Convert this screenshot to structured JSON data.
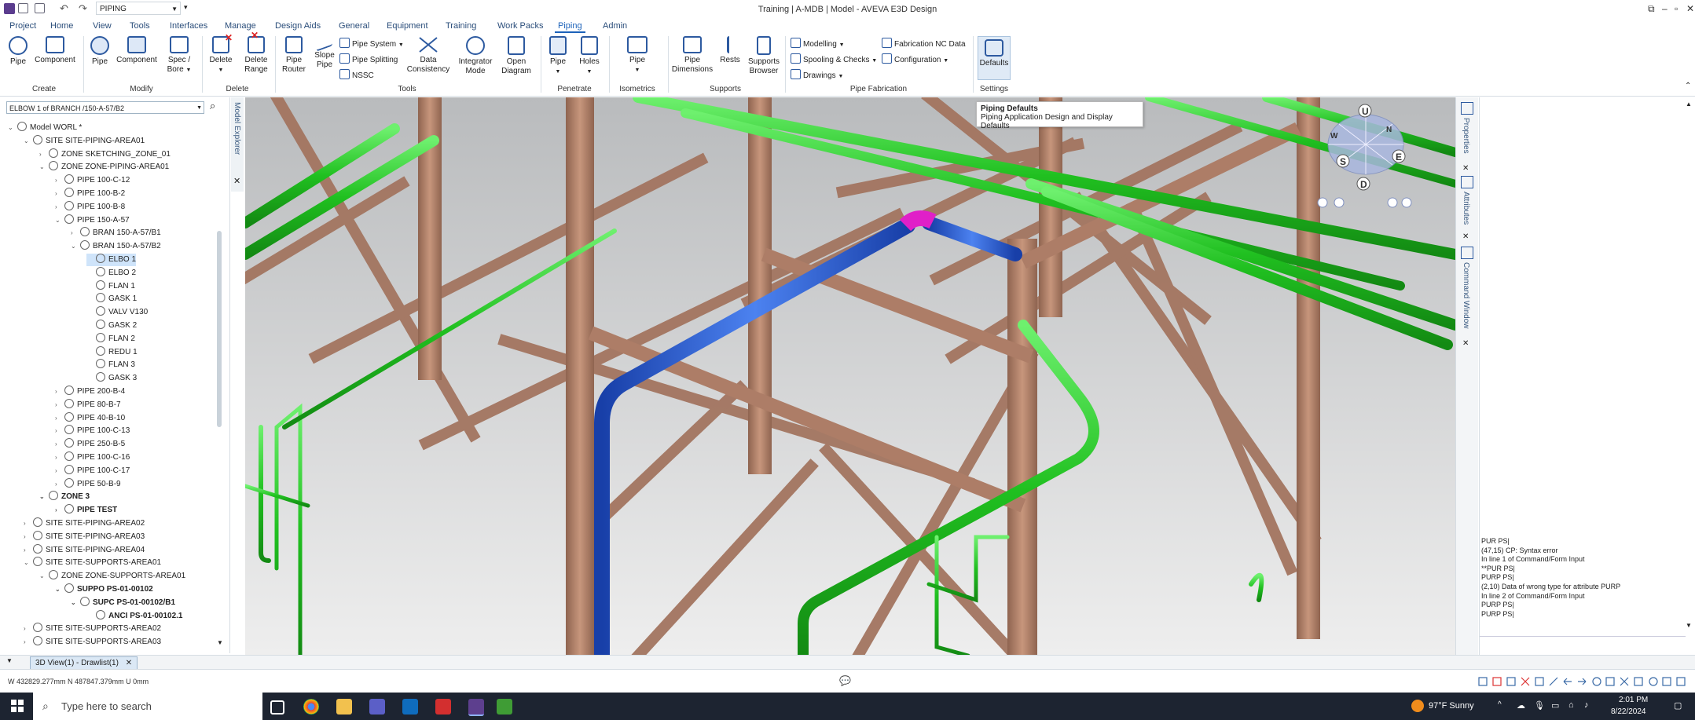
{
  "titlebar": {
    "app_title": "Training | A-MDB | Model - AVEVA E3D Design",
    "quick_access_module": "PIPING"
  },
  "menu": {
    "tabs": [
      "Project",
      "Home",
      "View",
      "Tools",
      "Interfaces",
      "Manage",
      "Design Aids",
      "General",
      "Equipment",
      "Training",
      "Work Packs",
      "Piping",
      "Admin"
    ],
    "active": "Piping"
  },
  "ribbon": {
    "groups": {
      "create": "Create",
      "modify": "Modify",
      "delete": "Delete",
      "tools": "Tools",
      "penetrate": "Penetrate",
      "isometrics": "Isometrics",
      "supports": "Supports",
      "pipe_fabrication": "Pipe Fabrication",
      "settings": "Settings"
    },
    "buttons": {
      "pipe": "Pipe",
      "component": "Component",
      "mod_pipe": "Pipe",
      "mod_component": "Component",
      "spec_bore_1": "Spec /",
      "spec_bore_2": "Bore",
      "delete": "Delete",
      "delete_range_1": "Delete",
      "delete_range_2": "Range",
      "pipe_router_1": "Pipe",
      "pipe_router_2": "Router",
      "slope_pipe_1": "Slope",
      "slope_pipe_2": "Pipe",
      "pipe_system": "Pipe System",
      "pipe_splitting": "Pipe Splitting",
      "nssc": "NSSC",
      "data_consistency_1": "Data",
      "data_consistency_2": "Consistency",
      "integrator_mode_1": "Integrator",
      "integrator_mode_2": "Mode",
      "open_diagram_1": "Open",
      "open_diagram_2": "Diagram",
      "pen_pipe": "Pipe",
      "holes": "Holes",
      "iso_pipe": "Pipe",
      "pipe_dimensions_1": "Pipe",
      "pipe_dimensions_2": "Dimensions",
      "rests": "Rests",
      "supports_browser_1": "Supports",
      "supports_browser_2": "Browser",
      "modelling": "Modelling",
      "spooling_checks": "Spooling & Checks",
      "drawings": "Drawings",
      "fabrication_nc_data": "Fabrication NC Data",
      "configuration": "Configuration",
      "defaults": "Defaults"
    }
  },
  "tooltip": {
    "title": "Piping Defaults",
    "description": "Piping Application Design and Display Defaults"
  },
  "explorer": {
    "current_element": "ELBOW 1 of BRANCH /150-A-57/B2",
    "side_tab": "Model Explorer",
    "tree": [
      {
        "label": "Model WORL *",
        "indent": 0,
        "exp": "v"
      },
      {
        "label": "SITE SITE-PIPING-AREA01",
        "indent": 1,
        "exp": "v"
      },
      {
        "label": "ZONE SKETCHING_ZONE_01",
        "indent": 2,
        "exp": ">"
      },
      {
        "label": "ZONE ZONE-PIPING-AREA01",
        "indent": 2,
        "exp": "v"
      },
      {
        "label": "PIPE 100-C-12",
        "indent": 3,
        "exp": ">"
      },
      {
        "label": "PIPE 100-B-2",
        "indent": 3,
        "exp": ">"
      },
      {
        "label": "PIPE 100-B-8",
        "indent": 3,
        "exp": ">"
      },
      {
        "label": "PIPE 150-A-57",
        "indent": 3,
        "exp": "v"
      },
      {
        "label": "BRAN 150-A-57/B1",
        "indent": 4,
        "exp": ">"
      },
      {
        "label": "BRAN 150-A-57/B2",
        "indent": 4,
        "exp": "v"
      },
      {
        "label": "ELBO 1",
        "indent": 5,
        "exp": "",
        "sel": true
      },
      {
        "label": "ELBO 2",
        "indent": 5,
        "exp": ""
      },
      {
        "label": "FLAN 1",
        "indent": 5,
        "exp": ""
      },
      {
        "label": "GASK 1",
        "indent": 5,
        "exp": ""
      },
      {
        "label": "VALV V130",
        "indent": 5,
        "exp": ""
      },
      {
        "label": "GASK 2",
        "indent": 5,
        "exp": ""
      },
      {
        "label": "FLAN 2",
        "indent": 5,
        "exp": ""
      },
      {
        "label": "REDU 1",
        "indent": 5,
        "exp": ""
      },
      {
        "label": "FLAN 3",
        "indent": 5,
        "exp": ""
      },
      {
        "label": "GASK 3",
        "indent": 5,
        "exp": ""
      },
      {
        "label": "PIPE 200-B-4",
        "indent": 3,
        "exp": ">"
      },
      {
        "label": "PIPE 80-B-7",
        "indent": 3,
        "exp": ">"
      },
      {
        "label": "PIPE 40-B-10",
        "indent": 3,
        "exp": ">"
      },
      {
        "label": "PIPE 100-C-13",
        "indent": 3,
        "exp": ">"
      },
      {
        "label": "PIPE 250-B-5",
        "indent": 3,
        "exp": ">"
      },
      {
        "label": "PIPE 100-C-16",
        "indent": 3,
        "exp": ">"
      },
      {
        "label": "PIPE 100-C-17",
        "indent": 3,
        "exp": ">"
      },
      {
        "label": "PIPE 50-B-9",
        "indent": 3,
        "exp": ">"
      },
      {
        "label": "ZONE 3",
        "indent": 2,
        "exp": "v",
        "bold": true
      },
      {
        "label": "PIPE TEST",
        "indent": 3,
        "exp": ">",
        "bold": true
      },
      {
        "label": "SITE SITE-PIPING-AREA02",
        "indent": 1,
        "exp": ">"
      },
      {
        "label": "SITE SITE-PIPING-AREA03",
        "indent": 1,
        "exp": ">"
      },
      {
        "label": "SITE SITE-PIPING-AREA04",
        "indent": 1,
        "exp": ">"
      },
      {
        "label": "SITE SITE-SUPPORTS-AREA01",
        "indent": 1,
        "exp": "v"
      },
      {
        "label": "ZONE ZONE-SUPPORTS-AREA01",
        "indent": 2,
        "exp": "v"
      },
      {
        "label": "SUPPO PS-01-00102",
        "indent": 3,
        "exp": "v",
        "bold": true
      },
      {
        "label": "SUPC PS-01-00102/B1",
        "indent": 4,
        "exp": "v",
        "bold": true
      },
      {
        "label": "ANCI PS-01-00102.1",
        "indent": 5,
        "exp": "",
        "bold": true
      },
      {
        "label": "SITE SITE-SUPPORTS-AREA02",
        "indent": 1,
        "exp": ">"
      },
      {
        "label": "SITE SITE-SUPPORTS-AREA03",
        "indent": 1,
        "exp": ">"
      }
    ]
  },
  "viewcube": {
    "u": "U",
    "d": "D",
    "w": "W",
    "e": "E",
    "s": "S",
    "n": "N"
  },
  "right_tabs": {
    "properties": "Properties",
    "attributes": "Attributes",
    "command_window": "Command Window"
  },
  "command_window": {
    "lines": [
      "PUR PS|",
      "(47,15)   CP: Syntax error",
      "  In line 1 of Command/Form Input",
      "  **PUR PS|",
      "PURP PS|",
      "(2,10)    Data of wrong type for attribute PURP",
      "  In line 2 of Command/Form Input",
      "PURP PS|",
      "PURP PS|"
    ]
  },
  "doc_tab": "3D View(1) - Drawlist(1)",
  "status": {
    "coordinates": "W 432829.277mm N 487847.379mm U 0mm"
  },
  "taskbar": {
    "search_placeholder": "Type here to search",
    "weather": "97°F  Sunny",
    "time": "2:01 PM",
    "date": "8/22/2024"
  },
  "colors": {
    "pipe_green": "#2ecc2e",
    "pipe_blue": "#2a5bd8",
    "steel": "#b7856a",
    "magenta": "#e020c8",
    "accent": "#1c62b9"
  }
}
